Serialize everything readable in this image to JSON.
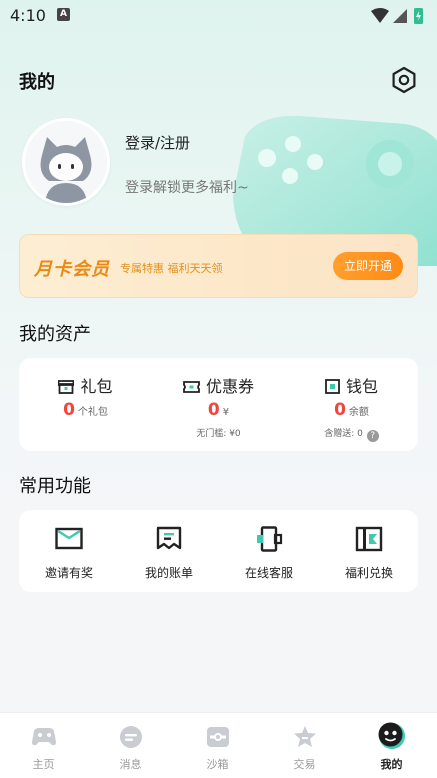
{
  "status_bar": {
    "time": "4:10",
    "notification_badge": "A"
  },
  "header": {
    "title": "我的"
  },
  "profile": {
    "login_label": "登录/注册",
    "subtitle": "登录解锁更多福利~"
  },
  "vip": {
    "title": "月卡会员",
    "subtitle": "专属特惠 福利天天领",
    "button": "立即开通"
  },
  "assets": {
    "title": "我的资产",
    "items": [
      {
        "label": "礼包",
        "value": "0",
        "unit": "个礼包",
        "note": ""
      },
      {
        "label": "优惠券",
        "value": "0",
        "unit": "¥",
        "note": "无门槛: ¥0"
      },
      {
        "label": "钱包",
        "value": "0",
        "unit": "余额",
        "note": "含赠送: 0"
      }
    ]
  },
  "functions": {
    "title": "常用功能",
    "items": [
      {
        "label": "邀请有奖",
        "icon": "envelope-icon"
      },
      {
        "label": "我的账单",
        "icon": "bill-icon"
      },
      {
        "label": "在线客服",
        "icon": "customer-service-icon"
      },
      {
        "label": "福利兑换",
        "icon": "exchange-icon"
      }
    ]
  },
  "nav": {
    "items": [
      {
        "label": "主页",
        "icon": "gamepad-icon"
      },
      {
        "label": "消息",
        "icon": "message-icon"
      },
      {
        "label": "沙箱",
        "icon": "sandbox-icon"
      },
      {
        "label": "交易",
        "icon": "trade-icon"
      },
      {
        "label": "我的",
        "icon": "mine-icon",
        "active": true
      }
    ]
  },
  "colors": {
    "accent": "#ff8a14",
    "price": "#f2443b",
    "teal": "#3ec9b0"
  }
}
